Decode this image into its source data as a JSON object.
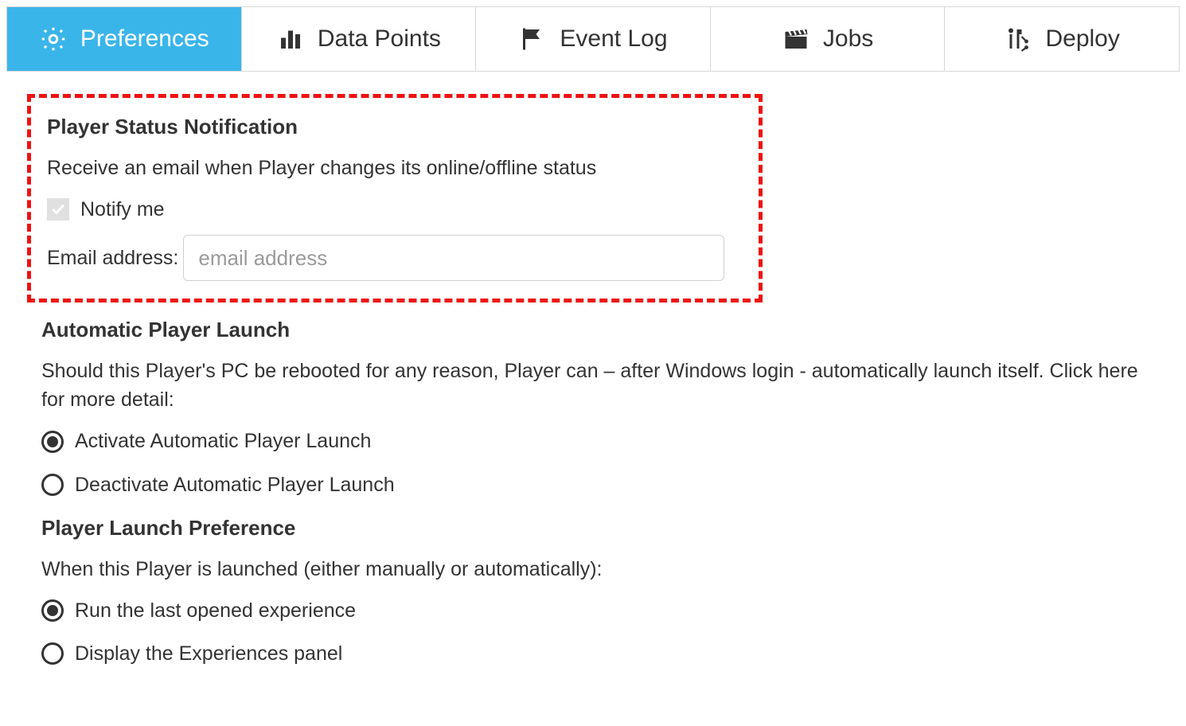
{
  "tabs": [
    {
      "label": "Preferences",
      "icon": "gear-icon",
      "active": true
    },
    {
      "label": "Data Points",
      "icon": "bar-chart-icon",
      "active": false
    },
    {
      "label": "Event Log",
      "icon": "flag-icon",
      "active": false
    },
    {
      "label": "Jobs",
      "icon": "clapper-icon",
      "active": false
    },
    {
      "label": "Deploy",
      "icon": "if-deploy-icon",
      "active": false
    }
  ],
  "status_notification": {
    "title": "Player Status Notification",
    "desc": "Receive an email when Player changes its online/offline status",
    "notify_label": "Notify me",
    "notify_checked": true,
    "email_label": "Email address:",
    "email_placeholder": "email address",
    "email_value": ""
  },
  "auto_launch": {
    "title": "Automatic Player Launch",
    "desc": "Should this Player's PC be rebooted for any reason, Player can – after Windows login - automatically launch itself. Click here for more detail:",
    "options": [
      {
        "label": "Activate Automatic Player Launch",
        "selected": true
      },
      {
        "label": "Deactivate Automatic Player Launch",
        "selected": false
      }
    ]
  },
  "launch_pref": {
    "title": "Player Launch Preference",
    "desc": "When this Player is launched (either manually or automatically):",
    "options": [
      {
        "label": "Run the last opened experience",
        "selected": true
      },
      {
        "label": "Display the Experiences panel",
        "selected": false
      }
    ]
  }
}
